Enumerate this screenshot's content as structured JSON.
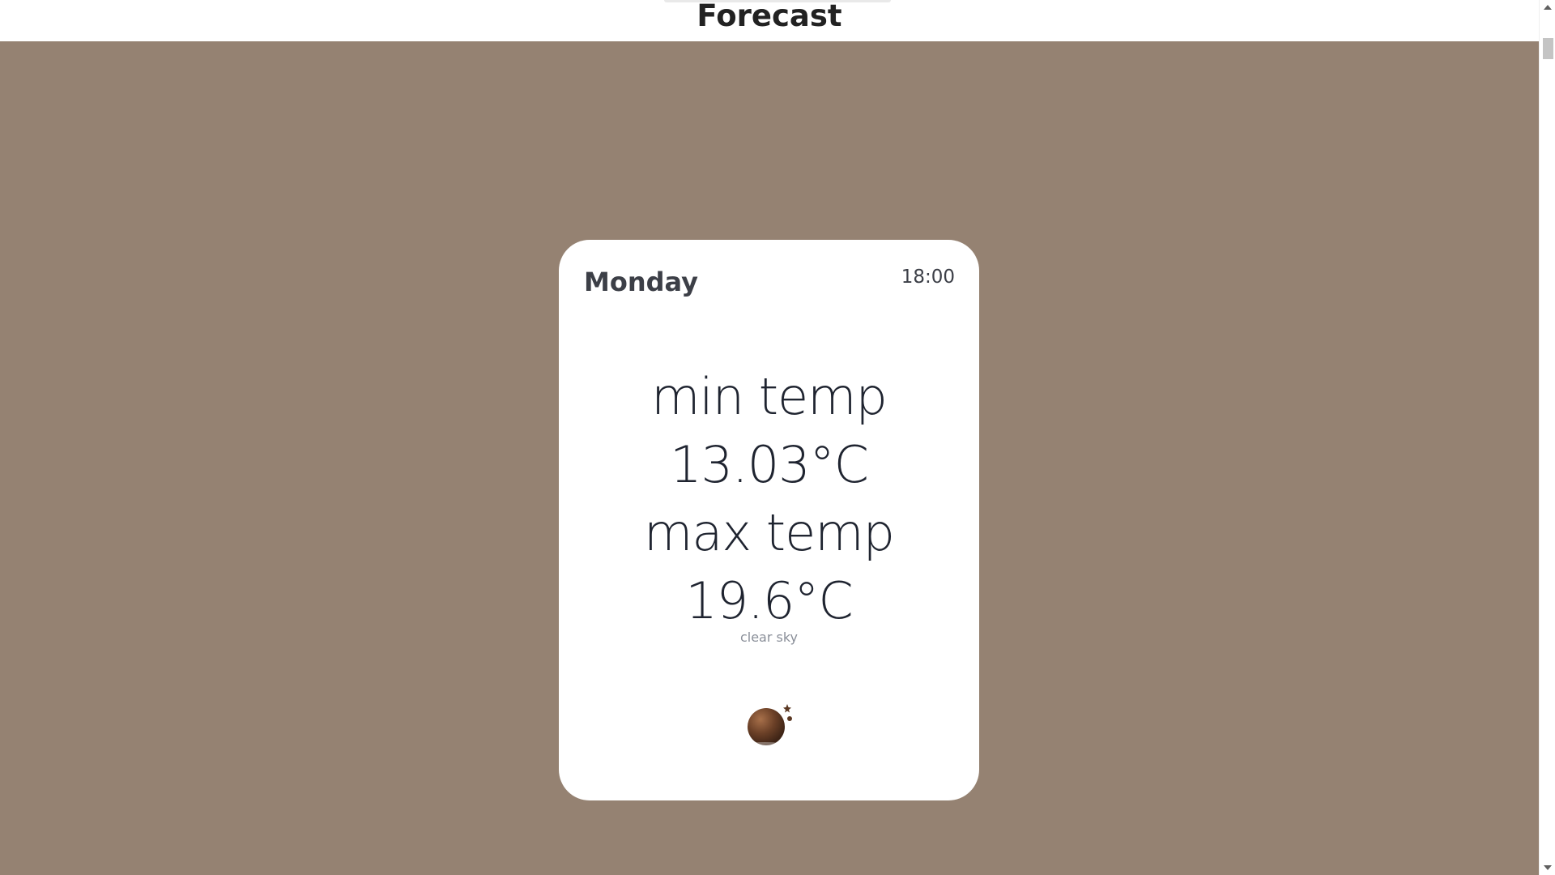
{
  "header": {
    "title": "Forecast"
  },
  "card": {
    "day": "Monday",
    "time": "18:00",
    "min_label": "min temp",
    "min_value": "13.03°C",
    "max_label": "max temp",
    "max_value": "19.6°C",
    "condition": "clear sky",
    "icon": "clear-night-icon"
  },
  "colors": {
    "background": "#958272",
    "card": "#ffffff",
    "icon": "#6b4027"
  }
}
